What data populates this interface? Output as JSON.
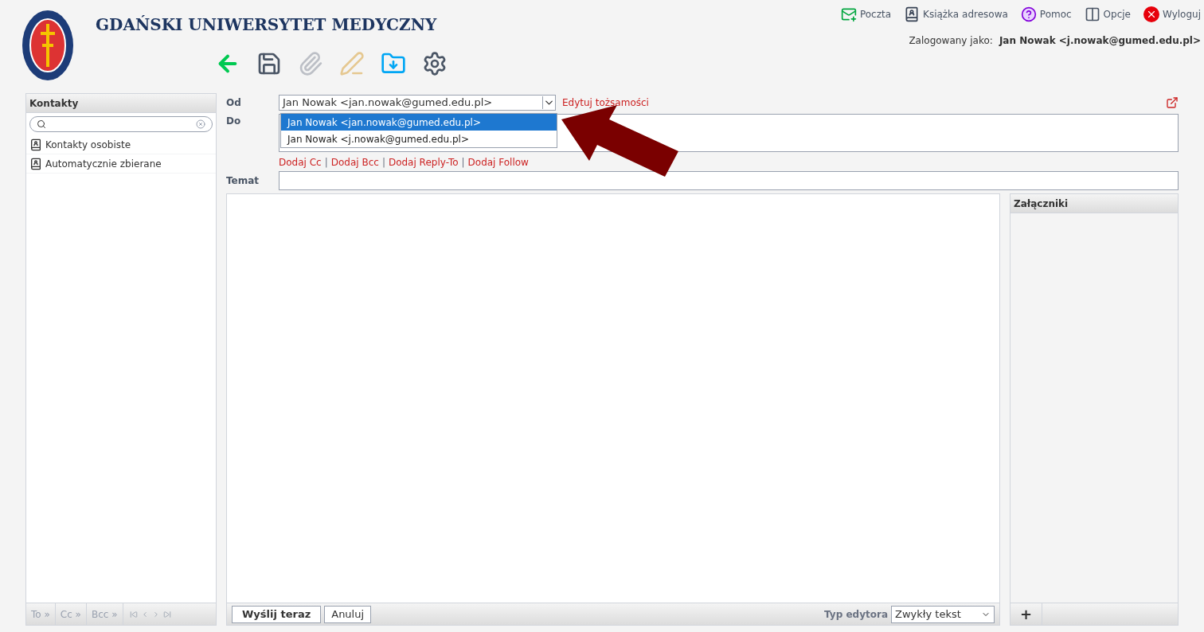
{
  "header": {
    "title": "GDAŃSKI UNIWERSYTET MEDYCZNY",
    "nav": [
      {
        "kind": "mail",
        "label": "Poczta"
      },
      {
        "kind": "book",
        "label": "Książka adresowa"
      },
      {
        "kind": "help",
        "label": "Pomoc"
      },
      {
        "kind": "options",
        "label": "Opcje"
      },
      {
        "kind": "logout",
        "label": "Wyloguj"
      }
    ],
    "login_label": "Zalogowany jako:",
    "login_user": "Jan Nowak <j.nowak@gumed.edu.pl>"
  },
  "toolbar": [
    {
      "kind": "back",
      "disabled": false
    },
    {
      "kind": "save",
      "disabled": false
    },
    {
      "kind": "attach",
      "disabled": true
    },
    {
      "kind": "signature",
      "disabled": true
    },
    {
      "kind": "folder",
      "disabled": false
    },
    {
      "kind": "gear",
      "disabled": false
    }
  ],
  "contacts": {
    "title": "Kontakty",
    "items": [
      {
        "label": "Kontakty osobiste",
        "selected": false
      },
      {
        "label": "Automatycznie zbierane",
        "selected": false
      }
    ],
    "footer": [
      "To »",
      "Cc »",
      "Bcc »"
    ]
  },
  "compose": {
    "from_label": "Od",
    "from_value": "Jan Nowak <jan.nowak@gumed.edu.pl>",
    "edit_link": "Edytuj tożsamości",
    "to_label": "Do",
    "options": [
      {
        "label": "Jan Nowak <jan.nowak@gumed.edu.pl>",
        "selected": true
      },
      {
        "label": "Jan Nowak <j.nowak@gumed.edu.pl>",
        "selected": false
      }
    ],
    "links": [
      "Dodaj Cc",
      "Dodaj Bcc",
      "Dodaj Reply-To",
      "Dodaj Follow"
    ],
    "link_separator": "|",
    "subject_label": "Temat",
    "send": "Wyślij teraz",
    "cancel": "Anuluj",
    "editor_label": "Typ edytora",
    "editor_value": "Zwykły tekst"
  },
  "attachments": {
    "title": "Załączniki",
    "add": "+"
  }
}
